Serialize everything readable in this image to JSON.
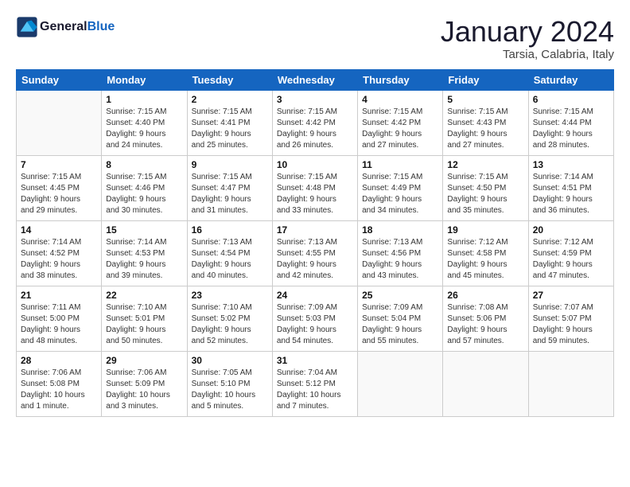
{
  "header": {
    "logo_general": "General",
    "logo_blue": "Blue",
    "title": "January 2024",
    "subtitle": "Tarsia, Calabria, Italy"
  },
  "columns": [
    "Sunday",
    "Monday",
    "Tuesday",
    "Wednesday",
    "Thursday",
    "Friday",
    "Saturday"
  ],
  "weeks": [
    [
      {
        "num": "",
        "empty": true
      },
      {
        "num": "1",
        "line1": "Sunrise: 7:15 AM",
        "line2": "Sunset: 4:40 PM",
        "line3": "Daylight: 9 hours",
        "line4": "and 24 minutes."
      },
      {
        "num": "2",
        "line1": "Sunrise: 7:15 AM",
        "line2": "Sunset: 4:41 PM",
        "line3": "Daylight: 9 hours",
        "line4": "and 25 minutes."
      },
      {
        "num": "3",
        "line1": "Sunrise: 7:15 AM",
        "line2": "Sunset: 4:42 PM",
        "line3": "Daylight: 9 hours",
        "line4": "and 26 minutes."
      },
      {
        "num": "4",
        "line1": "Sunrise: 7:15 AM",
        "line2": "Sunset: 4:42 PM",
        "line3": "Daylight: 9 hours",
        "line4": "and 27 minutes."
      },
      {
        "num": "5",
        "line1": "Sunrise: 7:15 AM",
        "line2": "Sunset: 4:43 PM",
        "line3": "Daylight: 9 hours",
        "line4": "and 27 minutes."
      },
      {
        "num": "6",
        "line1": "Sunrise: 7:15 AM",
        "line2": "Sunset: 4:44 PM",
        "line3": "Daylight: 9 hours",
        "line4": "and 28 minutes."
      }
    ],
    [
      {
        "num": "7",
        "line1": "Sunrise: 7:15 AM",
        "line2": "Sunset: 4:45 PM",
        "line3": "Daylight: 9 hours",
        "line4": "and 29 minutes."
      },
      {
        "num": "8",
        "line1": "Sunrise: 7:15 AM",
        "line2": "Sunset: 4:46 PM",
        "line3": "Daylight: 9 hours",
        "line4": "and 30 minutes."
      },
      {
        "num": "9",
        "line1": "Sunrise: 7:15 AM",
        "line2": "Sunset: 4:47 PM",
        "line3": "Daylight: 9 hours",
        "line4": "and 31 minutes."
      },
      {
        "num": "10",
        "line1": "Sunrise: 7:15 AM",
        "line2": "Sunset: 4:48 PM",
        "line3": "Daylight: 9 hours",
        "line4": "and 33 minutes."
      },
      {
        "num": "11",
        "line1": "Sunrise: 7:15 AM",
        "line2": "Sunset: 4:49 PM",
        "line3": "Daylight: 9 hours",
        "line4": "and 34 minutes."
      },
      {
        "num": "12",
        "line1": "Sunrise: 7:15 AM",
        "line2": "Sunset: 4:50 PM",
        "line3": "Daylight: 9 hours",
        "line4": "and 35 minutes."
      },
      {
        "num": "13",
        "line1": "Sunrise: 7:14 AM",
        "line2": "Sunset: 4:51 PM",
        "line3": "Daylight: 9 hours",
        "line4": "and 36 minutes."
      }
    ],
    [
      {
        "num": "14",
        "line1": "Sunrise: 7:14 AM",
        "line2": "Sunset: 4:52 PM",
        "line3": "Daylight: 9 hours",
        "line4": "and 38 minutes."
      },
      {
        "num": "15",
        "line1": "Sunrise: 7:14 AM",
        "line2": "Sunset: 4:53 PM",
        "line3": "Daylight: 9 hours",
        "line4": "and 39 minutes."
      },
      {
        "num": "16",
        "line1": "Sunrise: 7:13 AM",
        "line2": "Sunset: 4:54 PM",
        "line3": "Daylight: 9 hours",
        "line4": "and 40 minutes."
      },
      {
        "num": "17",
        "line1": "Sunrise: 7:13 AM",
        "line2": "Sunset: 4:55 PM",
        "line3": "Daylight: 9 hours",
        "line4": "and 42 minutes."
      },
      {
        "num": "18",
        "line1": "Sunrise: 7:13 AM",
        "line2": "Sunset: 4:56 PM",
        "line3": "Daylight: 9 hours",
        "line4": "and 43 minutes."
      },
      {
        "num": "19",
        "line1": "Sunrise: 7:12 AM",
        "line2": "Sunset: 4:58 PM",
        "line3": "Daylight: 9 hours",
        "line4": "and 45 minutes."
      },
      {
        "num": "20",
        "line1": "Sunrise: 7:12 AM",
        "line2": "Sunset: 4:59 PM",
        "line3": "Daylight: 9 hours",
        "line4": "and 47 minutes."
      }
    ],
    [
      {
        "num": "21",
        "line1": "Sunrise: 7:11 AM",
        "line2": "Sunset: 5:00 PM",
        "line3": "Daylight: 9 hours",
        "line4": "and 48 minutes."
      },
      {
        "num": "22",
        "line1": "Sunrise: 7:10 AM",
        "line2": "Sunset: 5:01 PM",
        "line3": "Daylight: 9 hours",
        "line4": "and 50 minutes."
      },
      {
        "num": "23",
        "line1": "Sunrise: 7:10 AM",
        "line2": "Sunset: 5:02 PM",
        "line3": "Daylight: 9 hours",
        "line4": "and 52 minutes."
      },
      {
        "num": "24",
        "line1": "Sunrise: 7:09 AM",
        "line2": "Sunset: 5:03 PM",
        "line3": "Daylight: 9 hours",
        "line4": "and 54 minutes."
      },
      {
        "num": "25",
        "line1": "Sunrise: 7:09 AM",
        "line2": "Sunset: 5:04 PM",
        "line3": "Daylight: 9 hours",
        "line4": "and 55 minutes."
      },
      {
        "num": "26",
        "line1": "Sunrise: 7:08 AM",
        "line2": "Sunset: 5:06 PM",
        "line3": "Daylight: 9 hours",
        "line4": "and 57 minutes."
      },
      {
        "num": "27",
        "line1": "Sunrise: 7:07 AM",
        "line2": "Sunset: 5:07 PM",
        "line3": "Daylight: 9 hours",
        "line4": "and 59 minutes."
      }
    ],
    [
      {
        "num": "28",
        "line1": "Sunrise: 7:06 AM",
        "line2": "Sunset: 5:08 PM",
        "line3": "Daylight: 10 hours",
        "line4": "and 1 minute."
      },
      {
        "num": "29",
        "line1": "Sunrise: 7:06 AM",
        "line2": "Sunset: 5:09 PM",
        "line3": "Daylight: 10 hours",
        "line4": "and 3 minutes."
      },
      {
        "num": "30",
        "line1": "Sunrise: 7:05 AM",
        "line2": "Sunset: 5:10 PM",
        "line3": "Daylight: 10 hours",
        "line4": "and 5 minutes."
      },
      {
        "num": "31",
        "line1": "Sunrise: 7:04 AM",
        "line2": "Sunset: 5:12 PM",
        "line3": "Daylight: 10 hours",
        "line4": "and 7 minutes."
      },
      {
        "num": "",
        "empty": true
      },
      {
        "num": "",
        "empty": true
      },
      {
        "num": "",
        "empty": true
      }
    ]
  ]
}
